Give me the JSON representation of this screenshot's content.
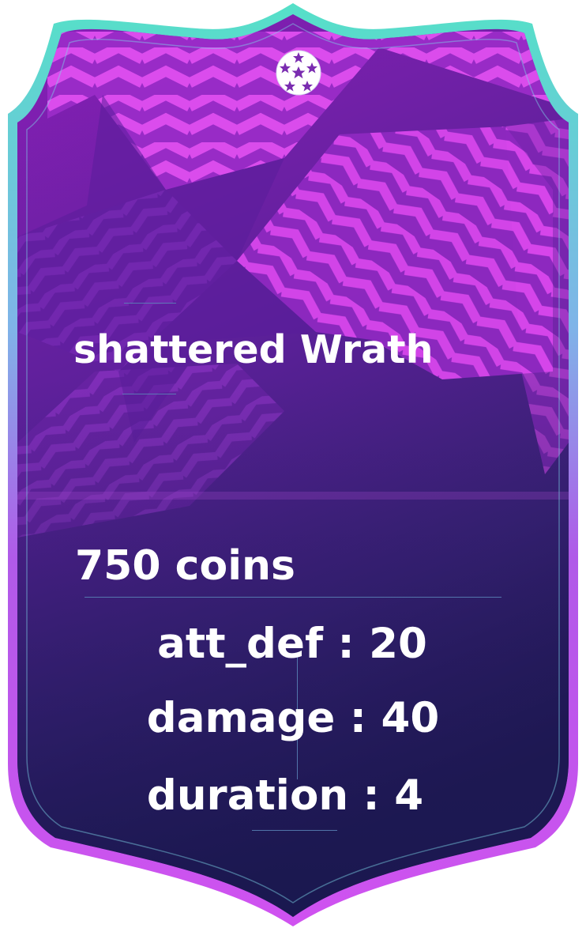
{
  "card": {
    "title": "shattered Wrath",
    "price": "750 coins",
    "stats": [
      "att_def : 20",
      "damage : 40",
      "duration : 4"
    ],
    "emblem_icon": "starball-icon",
    "colors": {
      "frame_outer": "#4ed6c8",
      "frame_bottom": "#c04ee8",
      "background_top": "#7a1ca8",
      "background_bottom": "#1a1448",
      "stripe_pink": "#d640e8",
      "text": "#ffffff"
    }
  }
}
